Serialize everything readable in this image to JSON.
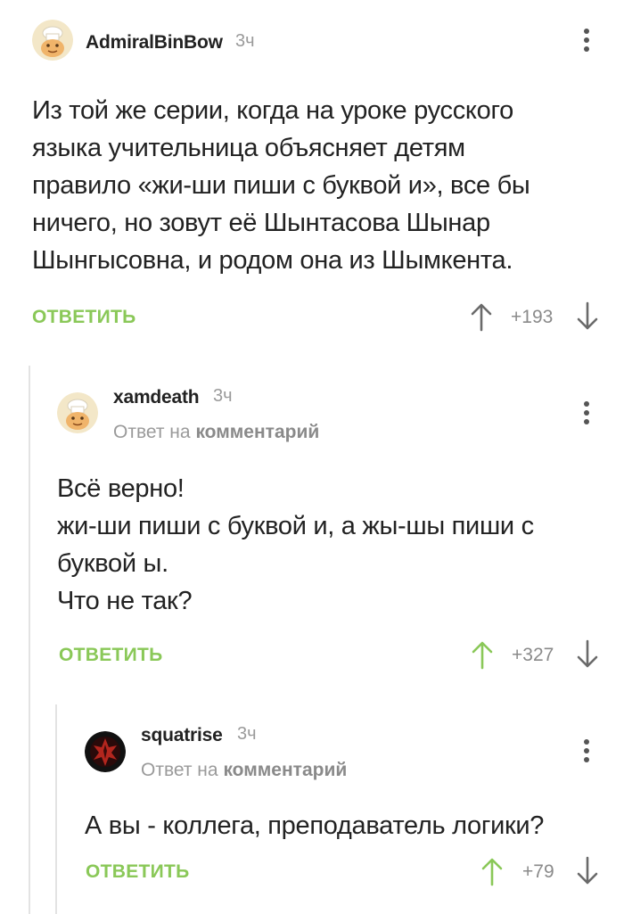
{
  "colors": {
    "accent_green": "#8ac858",
    "text": "#222222",
    "muted": "#9a9a9a",
    "thread_line": "#e3e3e3"
  },
  "comments": [
    {
      "username": "AdmiralBinBow",
      "time": "3ч",
      "avatar_icon": "chef-avatar",
      "lines": [
        "Из той же серии, когда на уроке русского",
        "языка учительница объясняет детям",
        "правило «жи-ши пиши с буквой и», все бы",
        "ничего, но зовут её Шынтасова Шынар",
        "Шынгысовна, и родом она из Шымкента."
      ],
      "reply_label": "ОТВЕТИТЬ",
      "rating": "+193",
      "up_active": false
    },
    {
      "username": "xamdeath",
      "time": "3ч",
      "avatar_icon": "chef-avatar",
      "reply_to_prefix": "Ответ на",
      "reply_to_link": "комментарий",
      "lines": [
        "Всё верно!",
        "жи-ши пиши с буквой и, а жы-шы пиши с",
        "буквой ы.",
        "Что не так?"
      ],
      "reply_label": "ОТВЕТИТЬ",
      "rating": "+327",
      "up_active": true
    },
    {
      "username": "squatrise",
      "time": "3ч",
      "avatar_icon": "horde-emblem-avatar",
      "reply_to_prefix": "Ответ на",
      "reply_to_link": "комментарий",
      "lines": [
        "А вы - коллега, преподаватель логики?"
      ],
      "reply_label": "ОТВЕТИТЬ",
      "rating": "+79",
      "up_active": true
    }
  ]
}
